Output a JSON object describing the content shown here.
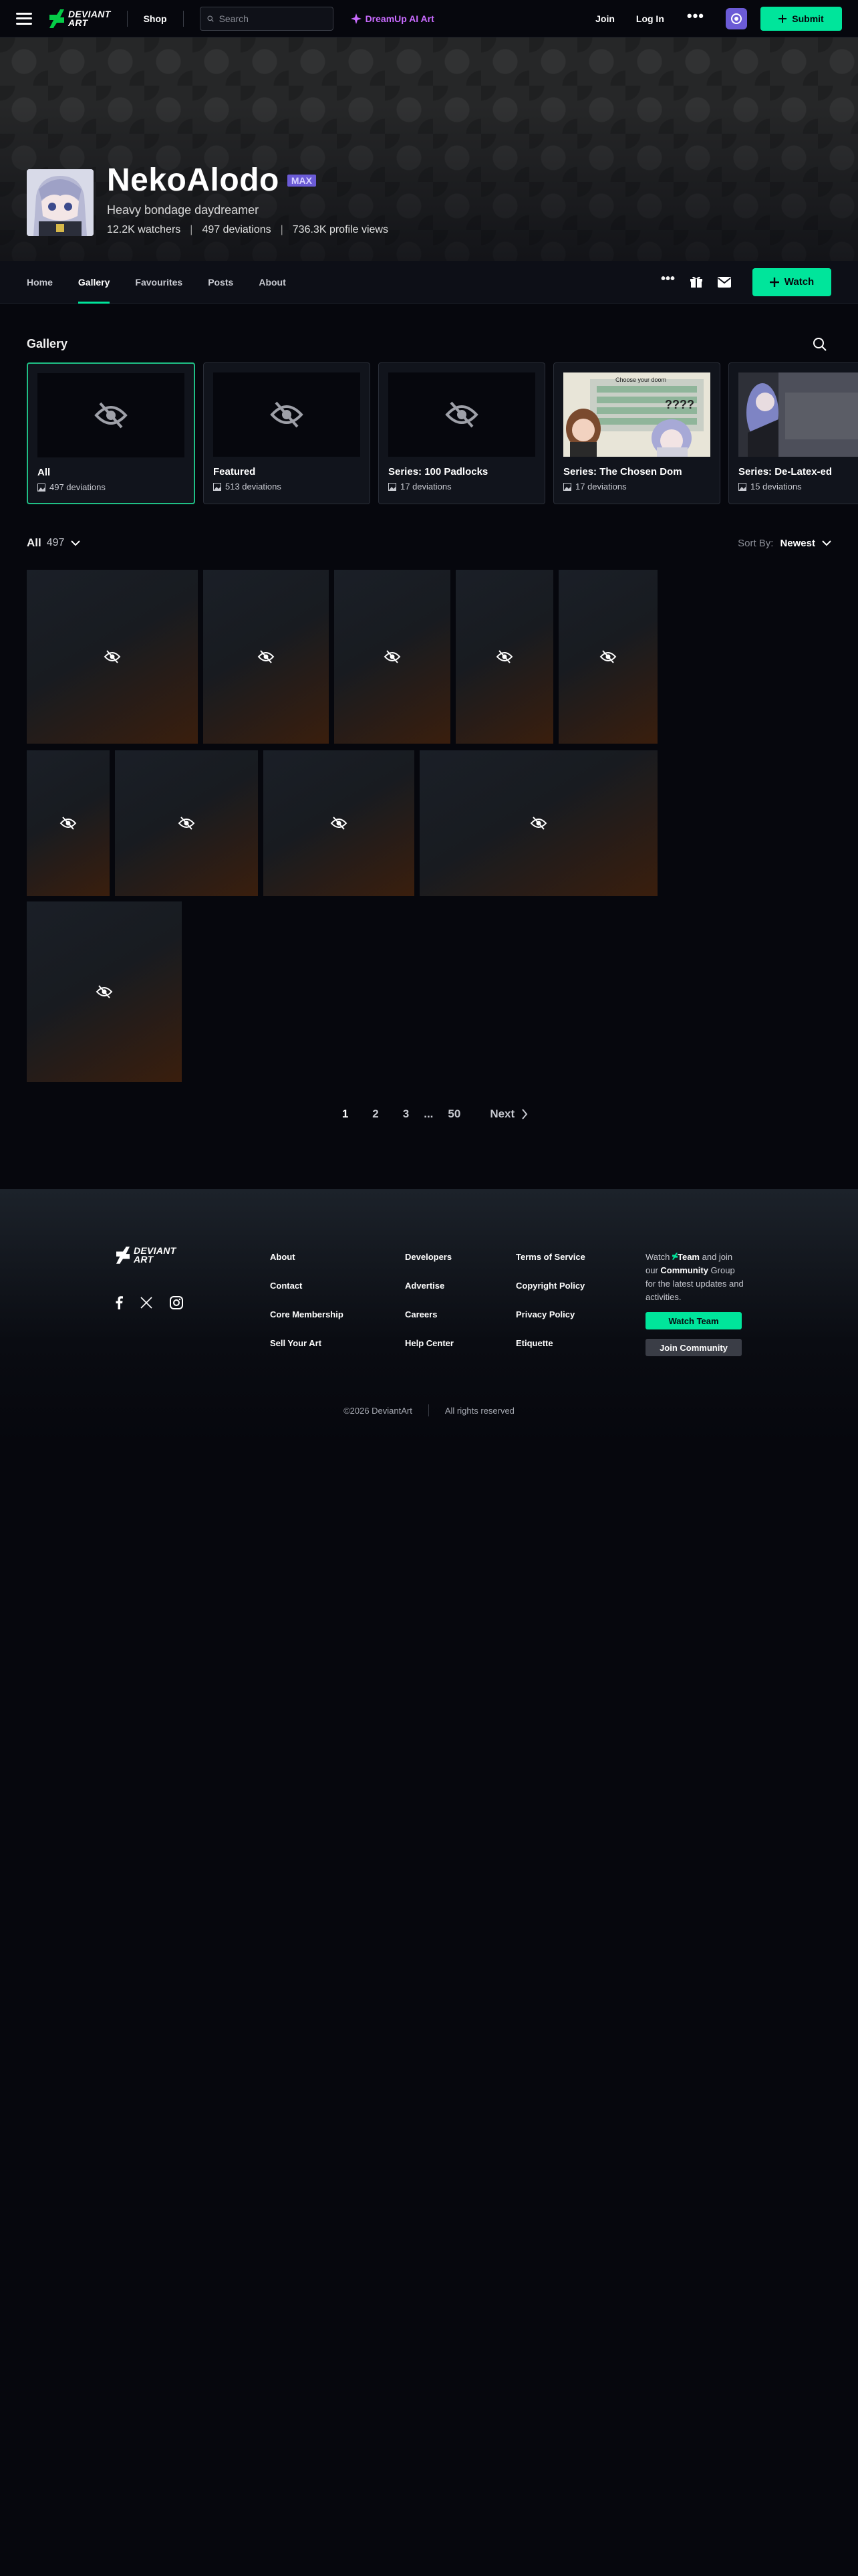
{
  "topnav": {
    "logo_line1": "DEVIANT",
    "logo_line2": "ART",
    "shop": "Shop",
    "search_placeholder": "Search",
    "dreamup": "DreamUp AI Art",
    "join": "Join",
    "login": "Log In",
    "more": "•••",
    "submit": "Submit",
    "accent": "#00e59b"
  },
  "profile": {
    "username": "NekoAlodo",
    "badge": "MAX",
    "tagline": "Heavy bondage daydreamer",
    "watchers": "12.2K watchers",
    "deviations": "497 deviations",
    "views": "736.3K profile views"
  },
  "tabs": [
    {
      "label": "Home",
      "active": false
    },
    {
      "label": "Gallery",
      "active": true
    },
    {
      "label": "Favourites",
      "active": false
    },
    {
      "label": "Posts",
      "active": false
    },
    {
      "label": "About",
      "active": false
    }
  ],
  "subnav": {
    "more": "•••",
    "watch": "Watch"
  },
  "gallery": {
    "title": "Gallery",
    "folders": [
      {
        "name": "All",
        "count": "497 deviations",
        "hidden": true
      },
      {
        "name": "Featured",
        "count": "513 deviations",
        "hidden": true
      },
      {
        "name": "Series: 100 Padlocks",
        "count": "17 deviations",
        "hidden": true
      },
      {
        "name": "Series: The Chosen Dom",
        "count": "17 deviations",
        "hidden": false,
        "thumb_caption": "Choose your doom",
        "thumb_marks": "????"
      },
      {
        "name": "Series: De-Latex-ed",
        "count": "15 deviations",
        "hidden": false
      }
    ],
    "filter_label": "All",
    "filter_count": "497",
    "sort_label": "Sort By:",
    "sort_value": "Newest"
  },
  "pagination": {
    "pages": [
      "1",
      "2",
      "3",
      "...",
      "50"
    ],
    "current": "1",
    "next": "Next"
  },
  "footer": {
    "col1": [
      "About",
      "Contact",
      "Core Membership",
      "Sell Your Art"
    ],
    "col2": [
      "Developers",
      "Advertise",
      "Careers",
      "Help Center"
    ],
    "col3": [
      "Terms of Service",
      "Copyright Policy",
      "Privacy Policy",
      "Etiquette"
    ],
    "cta_watch": "Watch",
    "cta_team": "Team",
    "cta_and_join": "and join our",
    "cta_community": "Community",
    "cta_rest": "Group for the latest updates and activities.",
    "watch_team": "Watch Team",
    "join_community": "Join Community",
    "copyright": "©2026 DeviantArt",
    "rights": "All rights reserved"
  }
}
